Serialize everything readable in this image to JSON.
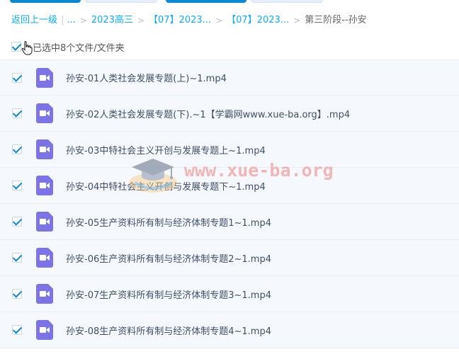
{
  "breadcrumb": {
    "back_label": "返回上一级",
    "ellipsis": "...",
    "items": [
      "2023高三",
      "【07】2023...",
      "【07】2023..."
    ],
    "current": "第三阶段--孙安"
  },
  "selection": {
    "all_checked": true,
    "summary": "已选中8个文件/文件夹"
  },
  "files": [
    {
      "name": "孙安-01人类社会发展专题(上)~1.mp4",
      "checked": true,
      "icon": "video-file-icon"
    },
    {
      "name": "孙安-02人类社会发展专题(下).~1【学霸网www.xue-ba.org】.mp4",
      "checked": true,
      "icon": "video-file-icon"
    },
    {
      "name": "孙安-03中特社会主义开创与发展专题上~1.mp4",
      "checked": true,
      "icon": "video-file-icon"
    },
    {
      "name": "孙安-04中特社会主义开创与发展专题下~1.mp4",
      "checked": true,
      "icon": "video-file-icon"
    },
    {
      "name": "孙安-05生产资料所有制与经济体制专题1~1.mp4",
      "checked": true,
      "icon": "video-file-icon"
    },
    {
      "name": "孙安-06生产资料所有制与经济体制专题2~1.mp4",
      "checked": true,
      "icon": "video-file-icon"
    },
    {
      "name": "孙安-07生产资料所有制与经济体制专题3~1.mp4",
      "checked": true,
      "icon": "video-file-icon"
    },
    {
      "name": "孙安-08生产资料所有制与经济体制专题4~1.mp4",
      "checked": true,
      "icon": "video-file-icon"
    }
  ],
  "watermark": {
    "text": "www.xue-ba.org"
  },
  "colors": {
    "accent": "#0a88d8",
    "link": "#09aaff",
    "video_icon": "#7b73e6",
    "row_bg": "#f5f8fc"
  }
}
